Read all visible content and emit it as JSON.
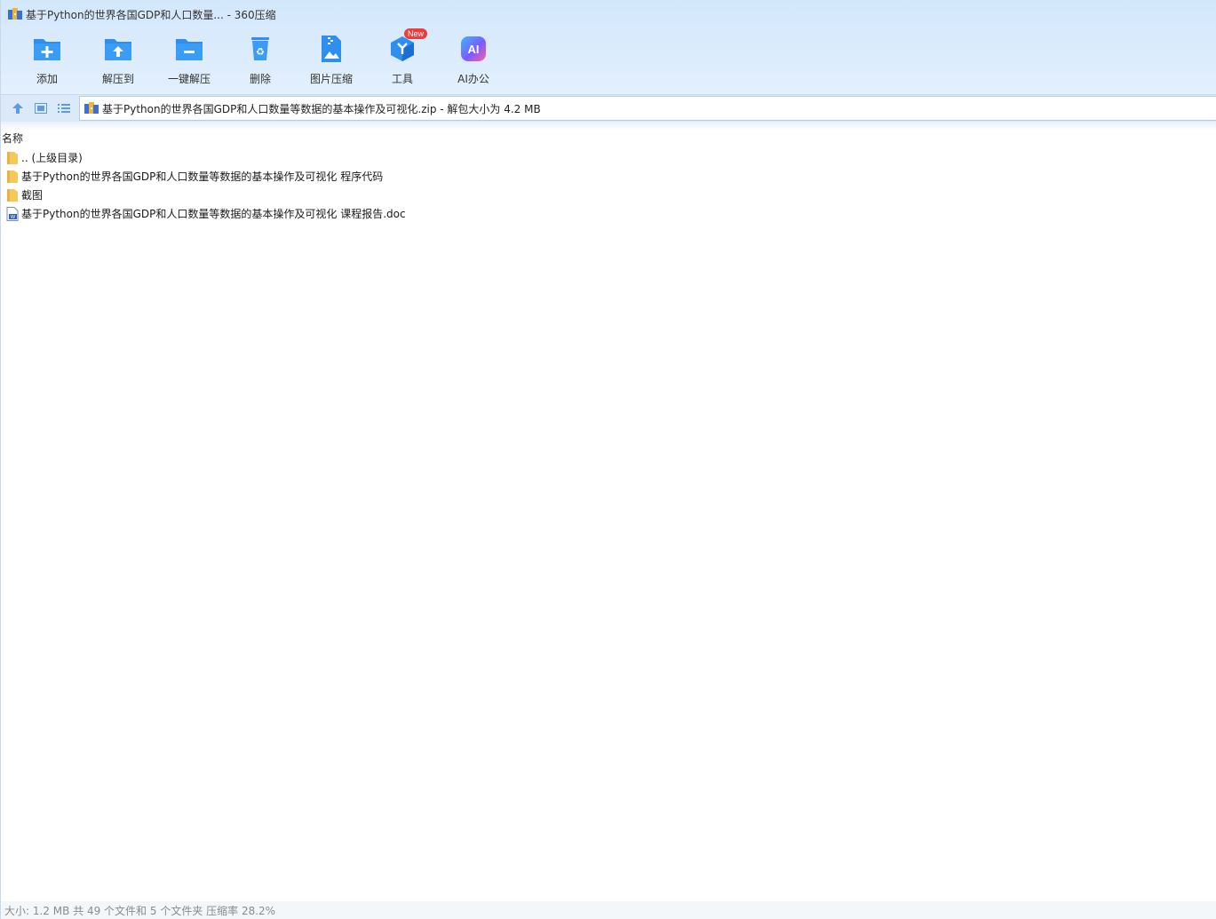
{
  "window": {
    "title": "基于Python的世界各国GDP和人口数量... - 360压缩"
  },
  "toolbar": {
    "items": [
      {
        "label": "添加",
        "icon": "add-to-archive-icon"
      },
      {
        "label": "解压到",
        "icon": "extract-to-icon"
      },
      {
        "label": "一键解压",
        "icon": "one-click-extract-icon"
      },
      {
        "label": "删除",
        "icon": "delete-icon"
      },
      {
        "label": "图片压缩",
        "icon": "image-compress-icon"
      },
      {
        "label": "工具",
        "icon": "tools-icon",
        "badge": "New"
      },
      {
        "label": "AI办公",
        "icon": "ai-office-icon",
        "icon_text": "AI"
      }
    ]
  },
  "address": {
    "path": "基于Python的世界各国GDP和人口数量等数据的基本操作及可视化.zip - 解包大小为 4.2 MB"
  },
  "list": {
    "column_name": "名称",
    "rows": [
      {
        "name": ".. (上级目录)",
        "type": "folder"
      },
      {
        "name": "基于Python的世界各国GDP和人口数量等数据的基本操作及可视化 程序代码",
        "type": "folder"
      },
      {
        "name": "截图",
        "type": "folder"
      },
      {
        "name": "基于Python的世界各国GDP和人口数量等数据的基本操作及可视化 课程报告.doc",
        "type": "word-doc"
      }
    ]
  },
  "status": {
    "text": "大小: 1.2 MB 共 49 个文件和 5 个文件夹 压缩率 28.2%"
  },
  "colors": {
    "accent": "#2f8ff0",
    "toolbar_bg": "#d3e7fb",
    "folder": "#f5c85a",
    "badge": "#ef3b3b"
  }
}
